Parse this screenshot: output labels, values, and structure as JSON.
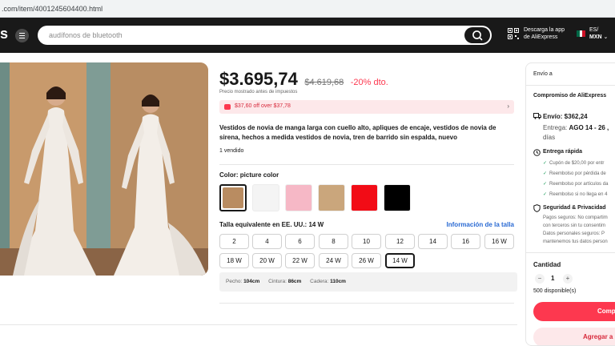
{
  "browser": {
    "url": ".com/item/4001245604400.html"
  },
  "header": {
    "logo_text": "s",
    "search_placeholder": "audífonos de bluetooth",
    "app_line1": "Descarga la app",
    "app_line2": "de AliExpress",
    "lang_line1": "ES/",
    "lang_line2": "MXN",
    "chevron": "⌄"
  },
  "colors": {
    "accent": "#fd384f",
    "header_bg": "#191919",
    "link": "#2a6ad3",
    "success": "#1b9c5a"
  },
  "product": {
    "price": "$3.695,74",
    "old_price": "$4.619,68",
    "discount": "-20% dto.",
    "tax_note": "Precio mostrado antes de impuestos",
    "coupon": "$37,60 off over $37,78",
    "title": "Vestidos de novia de manga larga con cuello alto, apliques de encaje, vestidos de novia de sirena, hechos a medida vestidos de novia, tren de barrido sin espalda, nuevo",
    "sold": "1 vendido",
    "color_label": "Color:",
    "color_value": "picture color",
    "swatches": [
      {
        "name": "picture color",
        "color": "#b98c61"
      },
      {
        "name": "white",
        "color": "#f4f4f4"
      },
      {
        "name": "pink",
        "color": "#f6b8c6"
      },
      {
        "name": "champagne",
        "color": "#caa67c"
      },
      {
        "name": "red",
        "color": "#f20c16"
      },
      {
        "name": "black",
        "color": "#000000"
      }
    ],
    "size_label": "Talla equivalente en EE. UU.:",
    "size_value": "14 W",
    "size_info": "Información de la talla",
    "sizes": [
      "2",
      "4",
      "6",
      "8",
      "10",
      "12",
      "14",
      "16",
      "16 W",
      "18 W",
      "20 W",
      "22 W",
      "24 W",
      "26 W",
      "14 W"
    ],
    "selected_size": "14 W",
    "measure": {
      "bust_label": "Pecho:",
      "bust": "104cm",
      "waist_label": "Cintura:",
      "waist": "86cm",
      "hip_label": "Cadera:",
      "hip": "110cm"
    }
  },
  "sidebar": {
    "ship_to": "Envío a",
    "commitment": "Compromiso de AliExpress",
    "shipping": "Envío: $362,24",
    "delivery_label": "Entrega:",
    "delivery_date": "AGO 14 - 26 ,",
    "delivery_days": "días",
    "fast_title": "Entrega rápida",
    "fast_items": [
      "Cupón de $20,00 por entr",
      "Reembolso por pérdida de",
      "Reembolso por artículos da",
      "Reembolso si no llega en 4"
    ],
    "security_title": "Seguridad & Privacidad",
    "security_lines": [
      "Pagos seguros: No compartim",
      "con terceros sin tu consentim",
      "Datos personales seguros: P",
      "mantenemos tus datos person"
    ],
    "qty_label": "Cantidad",
    "qty_minus": "−",
    "qty_value": "1",
    "qty_plus": "+",
    "available": "500 disponible(s)",
    "buy": "Comp",
    "cart": "Agregar a"
  }
}
